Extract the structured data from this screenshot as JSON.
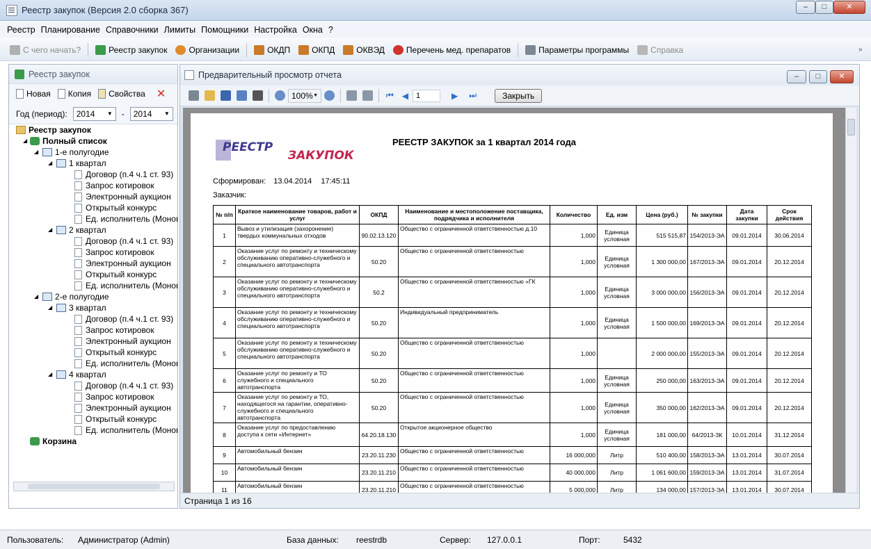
{
  "window": {
    "title": "Реестр закупок (Версия 2.0 сборка 367)",
    "min": "–",
    "max": "□",
    "close": "✕"
  },
  "menu": [
    "Реестр",
    "Планирование",
    "Справочники",
    "Лимиты",
    "Помощники",
    "Настройка",
    "Окна",
    "?"
  ],
  "toolbar": {
    "start": "С чего начать?",
    "registry": "Реестр закупок",
    "orgs": "Организации",
    "okdp": "ОКДП",
    "okpd": "ОКПД",
    "okved": "ОКВЭД",
    "meds": "Перечень мед. препаратов",
    "params": "Параметры программы",
    "help": "Справка"
  },
  "left": {
    "title": "Реестр закупок",
    "new": "Новая",
    "copy": "Копия",
    "props": "Свойства",
    "year_label": "Год (период):",
    "year_from": "2014",
    "dash": "-",
    "year_to": "2014",
    "tree": {
      "root": "Реестр закупок",
      "full": "Полный список",
      "h1": "1-е полугодие",
      "h2": "2-е полугодие",
      "q1": "1 квартал",
      "q2": "2 квартал",
      "q3": "3 квартал",
      "q4": "4 квартал",
      "trash": "Корзина",
      "items": [
        "Договор (п.4 ч.1 ст. 93)",
        "Запрос котировок",
        "Электронный аукцион",
        "Открытый конкурс",
        "Ед. исполнитель (Моноп"
      ]
    }
  },
  "preview": {
    "title": "Предварительный просмотр отчета",
    "zoom": "100%",
    "page": "1",
    "close": "Закрыть",
    "status": "Страница 1 из 16"
  },
  "report": {
    "logo": "РЕЕСТР ЗАКУПОК",
    "title": "РЕЕСТР ЗАКУПОК за 1 квартал 2014 года",
    "formed_label": "Сформирован:",
    "formed_date": "13.04.2014",
    "formed_time": "17:45:11",
    "customer": "Заказчик:",
    "headers": [
      "№ п/п",
      "Краткое наименование товаров, работ и услуг",
      "ОКПД",
      "Наименование и местоположение поставщика, подрядчика и исполнителя",
      "Количество",
      "Ед. изм",
      "Цена (руб.)",
      "№ закупки",
      "Дата закупки",
      "Срок действия"
    ],
    "rows": [
      [
        "1",
        "Вывоз и утилизация (захоронение) твердых коммунальных отходов",
        "90.02.13.120",
        "Общество с ограниченной ответственностью д.10",
        "1,000",
        "Единица условная",
        "515 515,87",
        "154/2013-ЭА",
        "09.01.2014",
        "30.06.2014"
      ],
      [
        "2",
        "Оказание услуг по ремонту и техническому обслуживанию оперативно-служебного и специального автотранспорта",
        "50.20",
        "Общество с ограниченной ответственностью",
        "1,000",
        "Единица условная",
        "1 300 000,00",
        "167/2013-ЭА",
        "09.01.2014",
        "20.12.2014"
      ],
      [
        "3",
        "Оказание услуг по ремонту и техническому обслуживанию оперативно-служебного и специального автотранспорта",
        "50.2",
        "Общество с ограниченной ответственностью «ГК",
        "1,000",
        "Единица условная",
        "3 000 000,00",
        "156/2013-ЭА",
        "09.01.2014",
        "20.12.2014"
      ],
      [
        "4",
        "Оказание услуг по ремонту и техническому обслуживанию оперативно-служебного и специального автотранспорта",
        "50.20",
        "Индивидуальный предприниматель",
        "1,000",
        "Единица условная",
        "1 500 000,00",
        "169/2013-ЭА",
        "09.01.2014",
        "20.12.2014"
      ],
      [
        "5",
        "Оказание услуг по ремонту и техническому обслуживанию оперативно-служебного и специального автотранспорта",
        "50.20",
        "Общество с ограниченной ответственностью",
        "1,000",
        "",
        "2 000 000,00",
        "155/2013-ЭА",
        "09.01.2014",
        "20.12.2014"
      ],
      [
        "6",
        "Оказание услуг по ремонту и ТО служебного и специального автотранспорта",
        "50.20",
        "Общество с ограниченной ответственностью",
        "1,000",
        "Единица условная",
        "250 000,00",
        "163/2013-ЭА",
        "09.01.2014",
        "20.12.2014"
      ],
      [
        "7",
        "Оказание услуг по ремонту и ТО, находящегося на гарантии, оперативно-служебного и специального автотранспорта",
        "50.20",
        "Общество с ограниченной ответственностью",
        "1,000",
        "Единица условная",
        "350 000,00",
        "162/2013-ЭА",
        "09.01.2014",
        "20.12.2014"
      ],
      [
        "8",
        "Оказание услуг по предоставлению доступа к сети «Интернет»",
        "64.20.18.130",
        "Открытое акционерное общество",
        "1,000",
        "Единица условная",
        "181 000,00",
        "64/2013-ЗК",
        "10.01.2014",
        "31.12.2014"
      ],
      [
        "9",
        "Автомобильный бензин",
        "23.20.11.230",
        "Общество с ограниченной ответственностью",
        "16 000,000",
        "Литр",
        "510 400,00",
        "158/2013-ЭА",
        "13.01.2014",
        "30.07.2014"
      ],
      [
        "10",
        "Автомобильный бензин",
        "23.20.11.210",
        "Общество с ограниченной ответственностью",
        "40 000,000",
        "Литр",
        "1 061 600,00",
        "159/2013-ЭА",
        "13.01.2014",
        "31.07.2014"
      ],
      [
        "11",
        "Автомобильный бензин",
        "23.20.11.210",
        "Общество с ограниченной ответственностью",
        "5 000,000",
        "Литр",
        "134 000,00",
        "157/2013-ЭА",
        "13.01.2014",
        "30.07.2014"
      ],
      [
        "",
        "Автомобильный бензин",
        "",
        "Общество с ограниченной ответственностью",
        "",
        "",
        "",
        "",
        "",
        ""
      ]
    ]
  },
  "statusbar": {
    "user_label": "Пользователь:",
    "user": "Администратор (Admin)",
    "db_label": "База данных:",
    "db": "reestrdb",
    "server_label": "Сервер:",
    "server": "127.0.0.1",
    "port_label": "Порт:",
    "port": "5432"
  }
}
